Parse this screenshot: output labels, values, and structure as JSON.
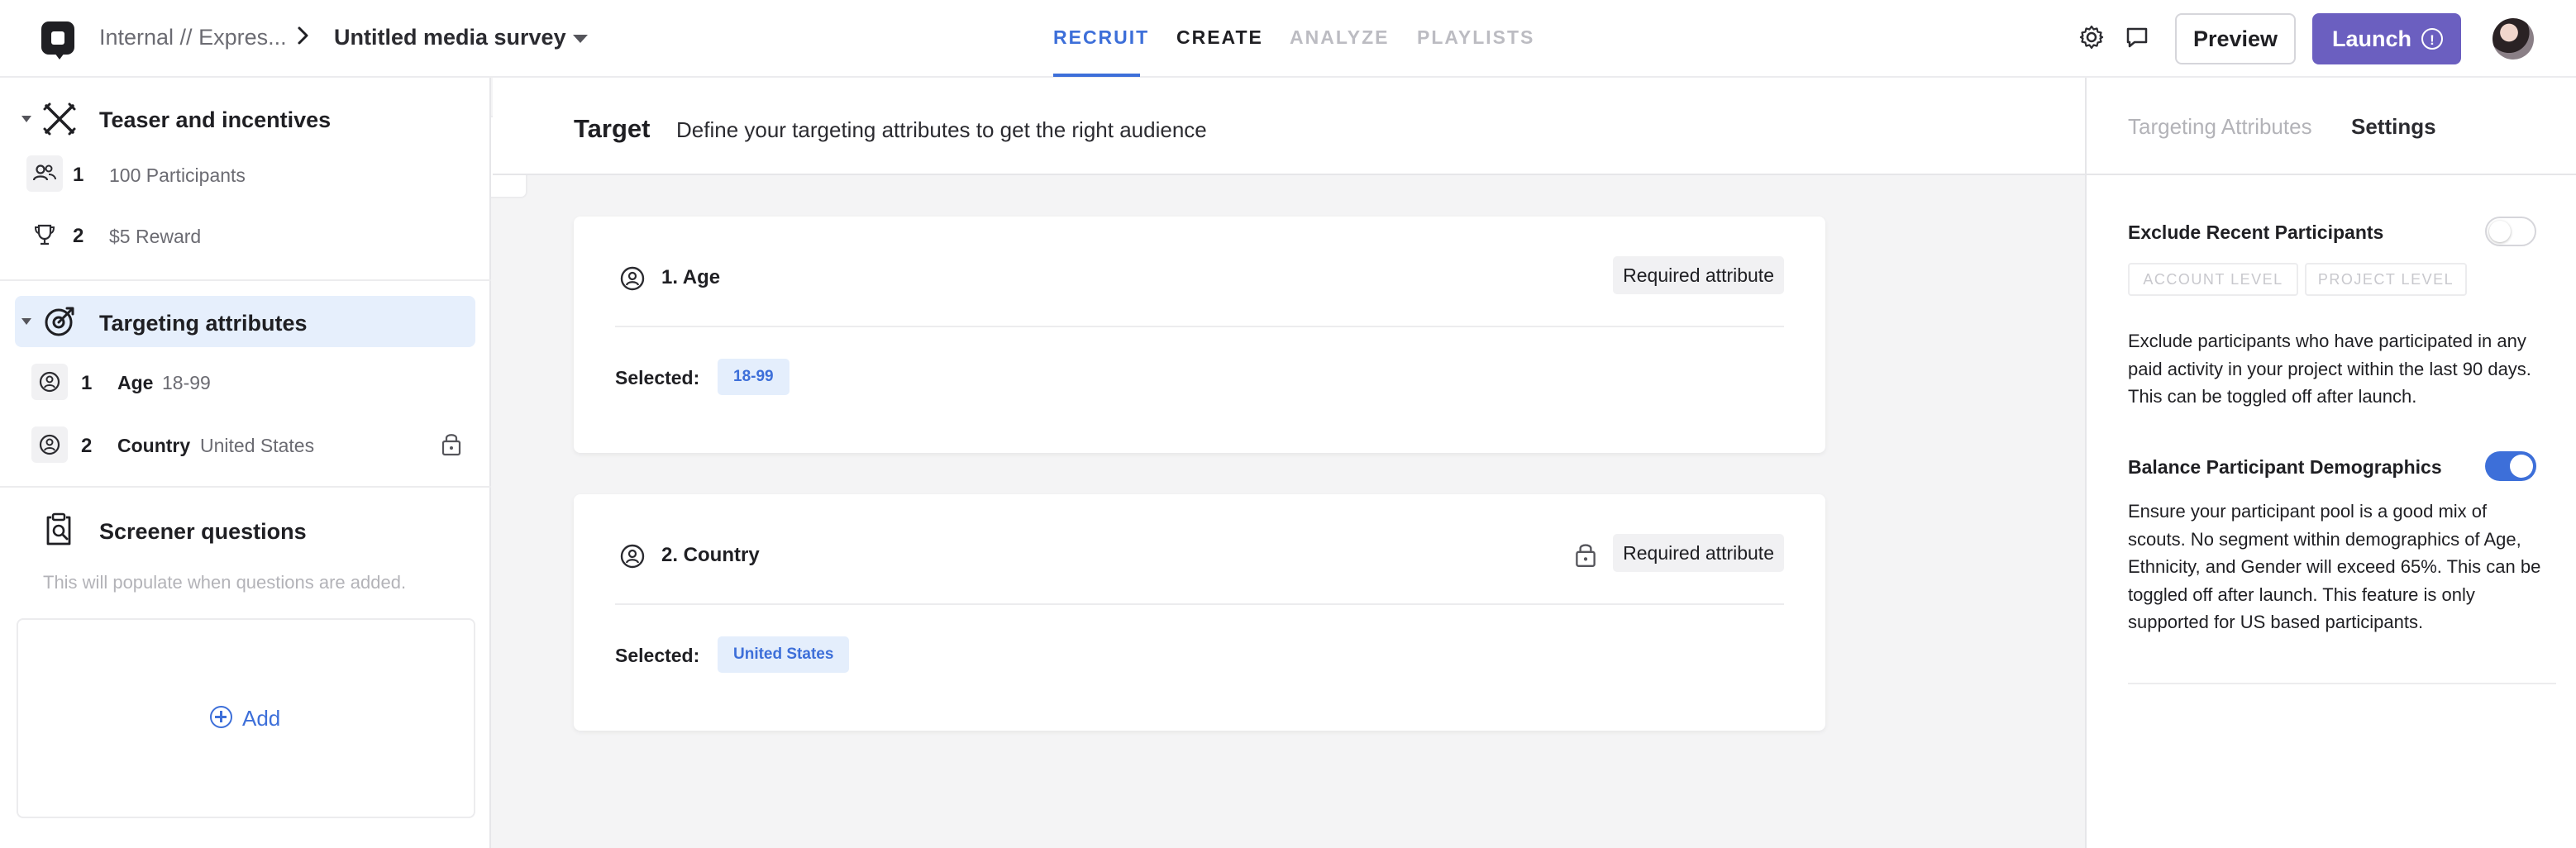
{
  "topbar": {
    "org": "Internal // Expres...",
    "survey_title": "Untitled media survey",
    "tabs": [
      "RECRUIT",
      "CREATE",
      "ANALYZE",
      "PLAYLISTS"
    ],
    "preview_label": "Preview",
    "launch_label": "Launch"
  },
  "sidebar": {
    "teaser": {
      "title": "Teaser and incentives",
      "items": [
        {
          "num": "1",
          "text": "100 Participants",
          "icon": "users-icon"
        },
        {
          "num": "2",
          "text": "$5 Reward",
          "icon": "trophy-icon"
        }
      ]
    },
    "targeting": {
      "title": "Targeting attributes",
      "items": [
        {
          "num": "1",
          "label": "Age",
          "value": "18-99"
        },
        {
          "num": "2",
          "label": "Country",
          "value": "United States"
        }
      ]
    },
    "screener": {
      "title": "Screener questions",
      "hint": "This will populate when questions are added.",
      "add_label": "Add"
    }
  },
  "main": {
    "title": "Target",
    "subtitle": "Define your targeting attributes to get the right audience",
    "cards": [
      {
        "title": "1. Age",
        "badge": "Required attribute",
        "selected_label": "Selected:",
        "chip": "18-99"
      },
      {
        "title": "2. Country",
        "badge": "Required attribute",
        "selected_label": "Selected:",
        "chip": "United States"
      }
    ]
  },
  "right_panel": {
    "tabs": [
      "Targeting Attributes",
      "Settings"
    ],
    "exclude": {
      "label": "Exclude Recent Participants",
      "enabled": false,
      "levels": [
        "ACCOUNT LEVEL",
        "PROJECT LEVEL"
      ],
      "description": "Exclude participants who have participated in any paid activity in your project within the last 90 days. This can be toggled off after launch."
    },
    "balance": {
      "label": "Balance Participant Demographics",
      "enabled": true,
      "description": "Ensure your participant pool is a good mix of scouts. No segment within demographics of Age, Ethnicity, and Gender will exceed 65%. This can be toggled off after launch. This feature is only supported for US based participants."
    }
  },
  "colors": {
    "accent": "#3d6fd9",
    "launch": "#6b5fc0",
    "highlight": "#e6effc"
  }
}
